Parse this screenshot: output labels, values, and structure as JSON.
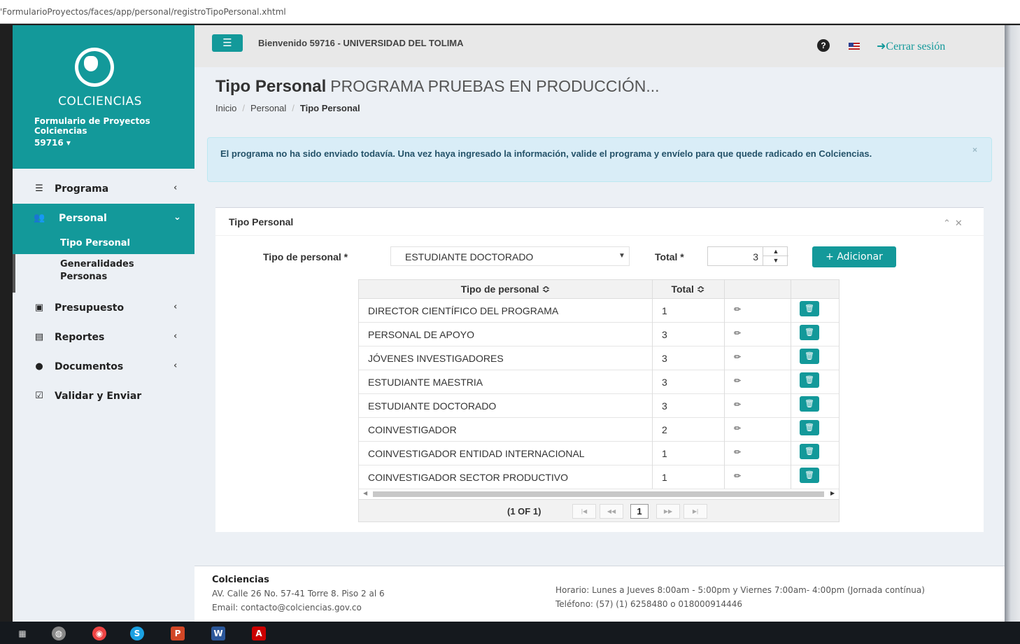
{
  "browser": {
    "url": "'FormularioProyectos/faces/app/personal/registroTipoPersonal.xhtml"
  },
  "brand": {
    "name": "COLCIENCIAS",
    "subtitle": "Formulario de Proyectos Colciencias",
    "user": "59716 ▾"
  },
  "sidebar": {
    "items": [
      {
        "label": "Programa",
        "icon": "list-icon"
      },
      {
        "label": "Personal",
        "icon": "users-icon"
      },
      {
        "label": "Presupuesto",
        "icon": "money-icon"
      },
      {
        "label": "Reportes",
        "icon": "file-icon"
      },
      {
        "label": "Documentos",
        "icon": "circle-icon"
      },
      {
        "label": "Validar y Enviar",
        "icon": "check-square-icon"
      }
    ],
    "sub_items": [
      {
        "label": "Tipo Personal"
      },
      {
        "label": "Generalidades Personas"
      }
    ]
  },
  "topbar": {
    "welcome": "Bienvenido 59716 - UNIVERSIDAD DEL TOLIMA",
    "logout": "Cerrar sesión"
  },
  "page": {
    "title": "Tipo Personal",
    "program": "PROGRAMA PRUEBAS EN PRODUCCIÓN...",
    "breadcrumb": [
      "Inicio",
      "Personal",
      "Tipo Personal"
    ]
  },
  "alert": {
    "message": "El programa no ha sido enviado todavía. Una vez haya ingresado la información, valide el programa y envíelo para que quede radicado en Colciencias.",
    "close": "×"
  },
  "panel": {
    "title": "Tipo Personal",
    "form": {
      "tipo_label": "Tipo de personal *",
      "tipo_value": "ESTUDIANTE DOCTORADO",
      "total_label": "Total *",
      "total_value": "3",
      "add_button": "+ Adicionar"
    },
    "table": {
      "headers": [
        "Tipo de personal ≎",
        "Total ≎"
      ],
      "rows": [
        {
          "tipo": "DIRECTOR CIENTÍFICO DEL PROGRAMA",
          "total": "1"
        },
        {
          "tipo": "PERSONAL DE APOYO",
          "total": "3"
        },
        {
          "tipo": "JÓVENES INVESTIGADORES",
          "total": "3"
        },
        {
          "tipo": "ESTUDIANTE MAESTRIA",
          "total": "3"
        },
        {
          "tipo": "ESTUDIANTE DOCTORADO",
          "total": "3"
        },
        {
          "tipo": "COINVESTIGADOR",
          "total": "2"
        },
        {
          "tipo": "COINVESTIGADOR ENTIDAD INTERNACIONAL",
          "total": "1"
        },
        {
          "tipo": "COINVESTIGADOR SECTOR PRODUCTIVO",
          "total": "1"
        }
      ],
      "pager": {
        "current": "(1 OF 1)",
        "page": "1"
      }
    }
  },
  "footer": {
    "org": "Colciencias",
    "address": "AV. Calle 26 No. 57-41 Torre 8. Piso 2 al 6",
    "email": "Email: contacto@colciencias.gov.co",
    "hours": "Horario: Lunes a Jueves 8:00am - 5:00pm y Viernes 7:00am- 4:00pm (Jornada contínua)",
    "phone": "Teléfono: (57) (1) 6258480 o 018000914446"
  },
  "colors": {
    "primary": "#13999a",
    "alert_bg": "#d9edf7"
  }
}
